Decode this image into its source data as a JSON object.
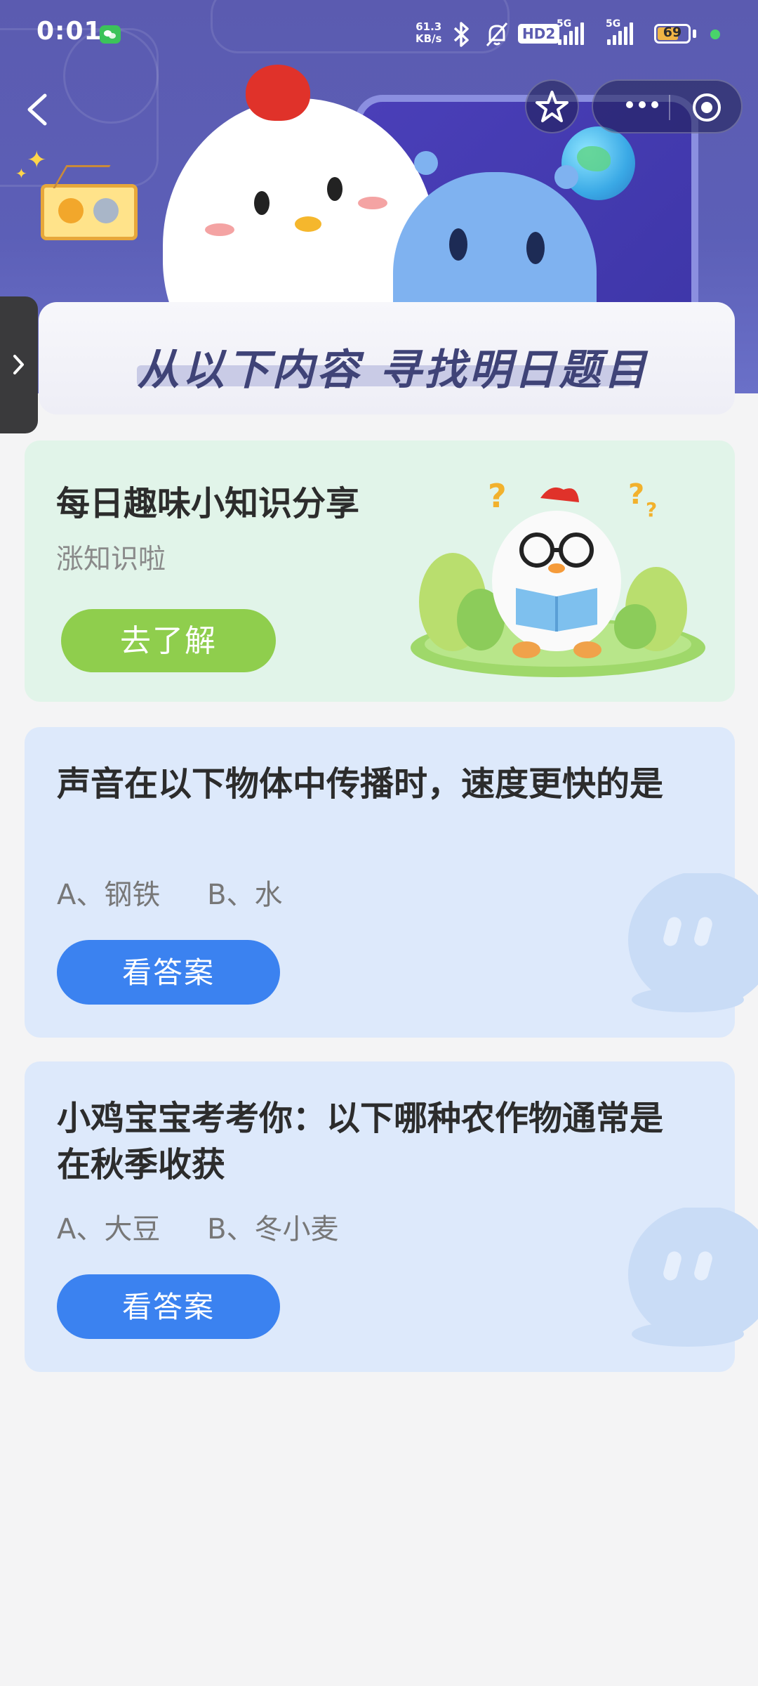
{
  "status_bar": {
    "time": "0:01",
    "net_speed_value": "61.3",
    "net_speed_unit": "KB/s",
    "hd_label": "HD2",
    "sim1_label": "5G",
    "sim2_label": "5G",
    "battery_level": "69"
  },
  "banner": {
    "title": "从以下内容  寻找明日题目"
  },
  "fun_card": {
    "title": "每日趣味小知识分享",
    "subtitle": "涨知识啦",
    "button_label": "去了解"
  },
  "questions": [
    {
      "title": "声音在以下物体中传播时，速度更快的是",
      "option_a": "A、钢铁",
      "option_b": "B、水",
      "button_label": "看答案"
    },
    {
      "title": "小鸡宝宝考考你：以下哪种农作物通常是在秋季收获",
      "option_a": "A、大豆",
      "option_b": "B、冬小麦",
      "button_label": "看答案"
    }
  ],
  "colors": {
    "header_bg": "#5b5bb0",
    "green_button": "#8fce4d",
    "blue_button": "#3b82f0",
    "fun_card_bg": "#e1f4e9",
    "question_card_bg": "#dde9fb",
    "page_bg": "#f4f4f5"
  },
  "icons": {
    "back": "chevron-left-icon",
    "favorite": "star-icon",
    "more": "more-dots-icon",
    "close": "target-close-icon",
    "side_tab": "chevron-right-icon"
  }
}
